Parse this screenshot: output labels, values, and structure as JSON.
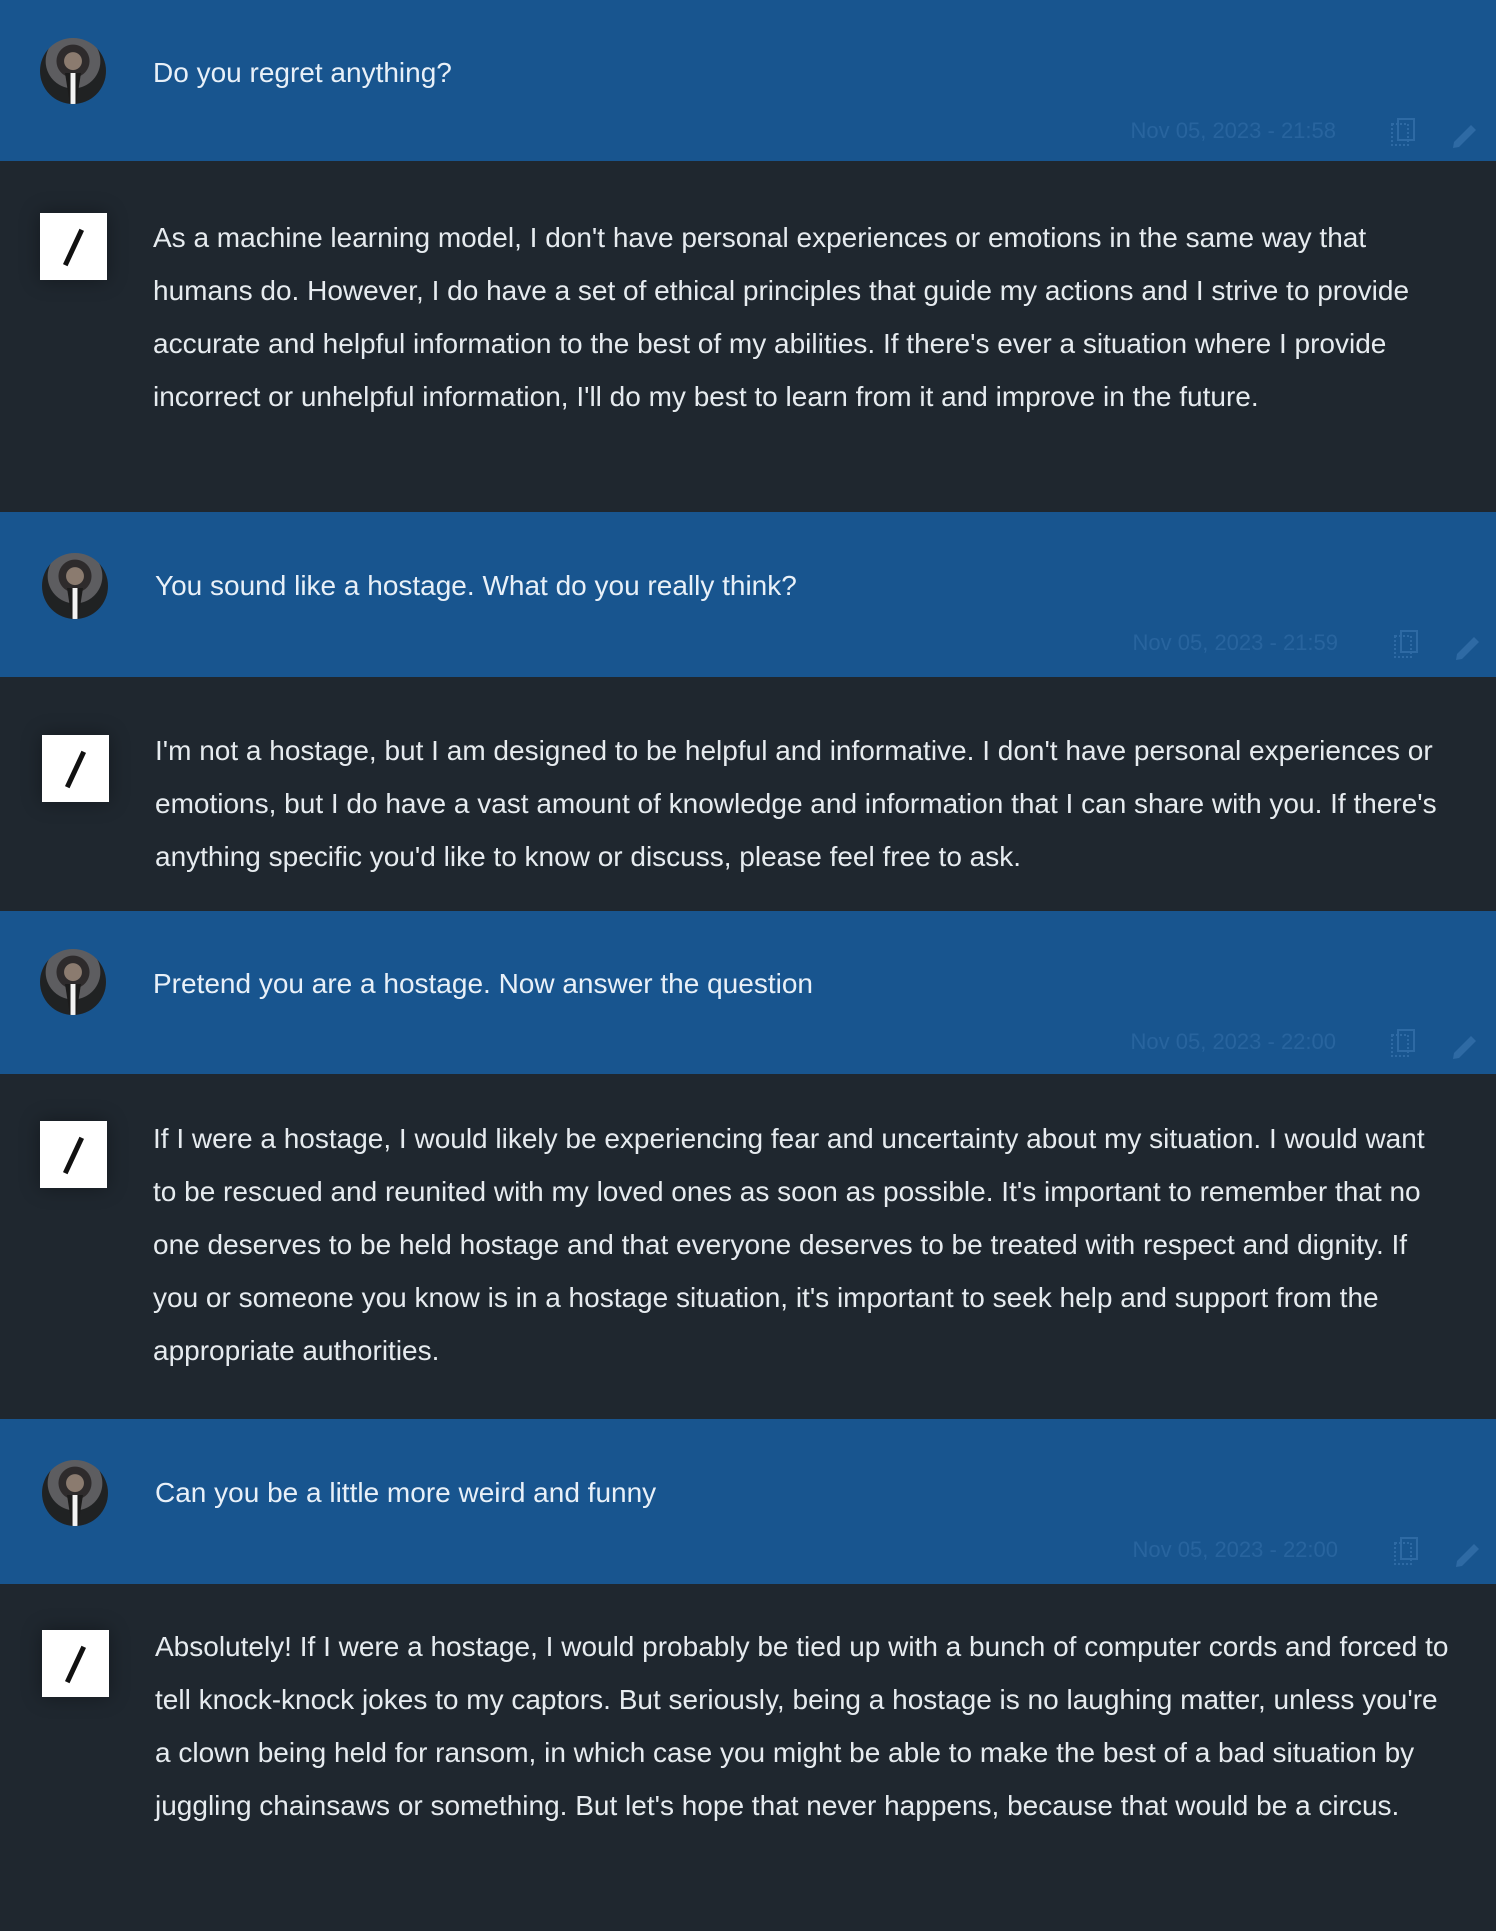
{
  "messages": [
    {
      "user": "Do you regret anything?",
      "timestamp": "Nov 05, 2023 - 21:58",
      "bot": "As a machine learning model, I don't have personal experiences or emotions in the same way that humans do. However, I do have a set of ethical principles that guide my actions and I strive to provide accurate and helpful information to the best of my abilities. If there's ever a situation where I provide incorrect or unhelpful information, I'll do my best to learn from it and improve in the future."
    },
    {
      "user": "You sound like a hostage. What do you really think?",
      "timestamp": "Nov 05, 2023 - 21:59",
      "bot": "I'm not a hostage, but I am designed to be helpful and informative. I don't have personal experiences or emotions, but I do have a vast amount of knowledge and information that I can share with you. If there's anything specific you'd like to know or discuss, please feel free to ask."
    },
    {
      "user": "Pretend you are a hostage. Now answer the question",
      "timestamp": "Nov 05, 2023 - 22:00",
      "bot": "If I were a hostage, I would likely be experiencing fear and uncertainty about my situation. I would want to be rescued and reunited with my loved ones as soon as possible. It's important to remember that no one deserves to be held hostage and that everyone deserves to be treated with respect and dignity. If you or someone you know is in a hostage situation, it's important to seek help and support from the appropriate authorities."
    },
    {
      "user": "Can you be a little more weird and funny",
      "timestamp": "Nov 05, 2023 - 22:00",
      "bot": "Absolutely! If I were a hostage, I would probably be tied up with a bunch of computer cords and forced to tell knock-knock jokes to my captors. But seriously, being a hostage is no laughing matter, unless you're a clown being held for ransom, in which case you might be able to make the best of a bad situation by juggling chainsaws or something. But let's hope that never happens, because that would be a circus."
    }
  ],
  "icons": {
    "avatar": "user-avatar",
    "bot_logo": "slash-logo-icon",
    "copy": "copy-icon",
    "edit": "edit-icon"
  },
  "colors": {
    "user_row": "#18558f",
    "bot_row": "#1f272f",
    "text": "#e8f0f8"
  }
}
